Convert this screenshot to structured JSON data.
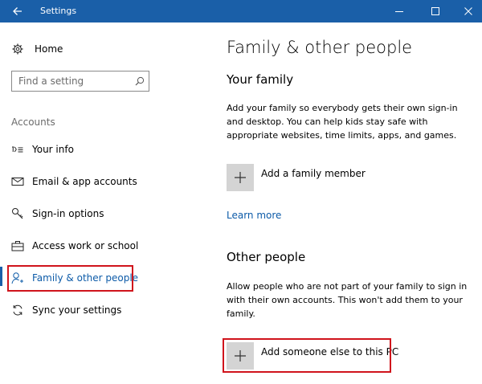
{
  "window": {
    "title": "Settings",
    "back_icon": "back-arrow-icon",
    "minimize_icon": "minimize-icon",
    "maximize_icon": "maximize-icon",
    "close_icon": "close-icon",
    "titlebar_color": "#1a5fa8"
  },
  "sidebar": {
    "home_label": "Home",
    "home_icon": "gear-icon",
    "search_placeholder": "Find a setting",
    "section_heading": "Accounts",
    "items": [
      {
        "label": "Your info",
        "icon": "person-card-icon"
      },
      {
        "label": "Email & app accounts",
        "icon": "mail-icon"
      },
      {
        "label": "Sign-in options",
        "icon": "key-icon"
      },
      {
        "label": "Access work or school",
        "icon": "briefcase-icon"
      },
      {
        "label": "Family & other people",
        "icon": "person-add-icon",
        "selected": true
      },
      {
        "label": "Sync your settings",
        "icon": "sync-icon"
      }
    ],
    "accent_color": "#1a5fa8",
    "highlight_color": "#d0141c"
  },
  "main": {
    "title": "Family & other people",
    "family": {
      "heading": "Your family",
      "description": "Add your family so everybody gets their own sign-in and desktop. You can help kids stay safe with appropriate websites, time limits, apps, and games.",
      "add_label": "Add a family member",
      "learn_more": "Learn more"
    },
    "other": {
      "heading": "Other people",
      "description": "Allow people who are not part of your family to sign in with their own accounts. This won't add them to your family.",
      "add_label": "Add someone else to this PC"
    },
    "link_color": "#0d5ba8"
  }
}
